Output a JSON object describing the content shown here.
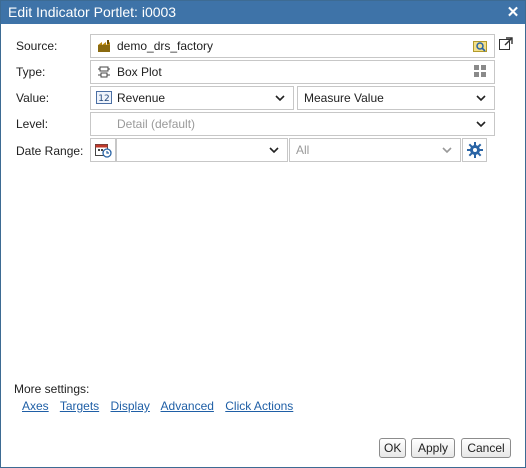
{
  "dialog": {
    "title": "Edit Indicator Portlet: i0003"
  },
  "form": {
    "source": {
      "label": "Source:",
      "value": "demo_drs_factory"
    },
    "type": {
      "label": "Type:",
      "value": "Box Plot"
    },
    "value": {
      "label": "Value:",
      "measure": "Revenue",
      "measure_type": "Measure Value"
    },
    "level": {
      "label": "Level:",
      "value": "Detail (default)"
    },
    "date_range": {
      "label": "Date Range:",
      "value": "",
      "period": "All"
    }
  },
  "more_settings": {
    "label": "More settings:",
    "links": [
      "Axes",
      "Targets",
      "Display",
      "Advanced",
      "Click Actions"
    ]
  },
  "buttons": {
    "ok": "OK",
    "apply": "Apply",
    "cancel": "Cancel"
  },
  "icons": {
    "source": "factory-icon",
    "browse": "folder-search-icon",
    "open": "open-external-icon",
    "type": "box-plot-icon",
    "grid": "grid-icon",
    "measure": "number-measure-icon",
    "calendar": "calendar-clock-icon",
    "settings": "gear-icon"
  },
  "colors": {
    "titlebar": "#3e73a8",
    "link": "#1f5fa6"
  }
}
